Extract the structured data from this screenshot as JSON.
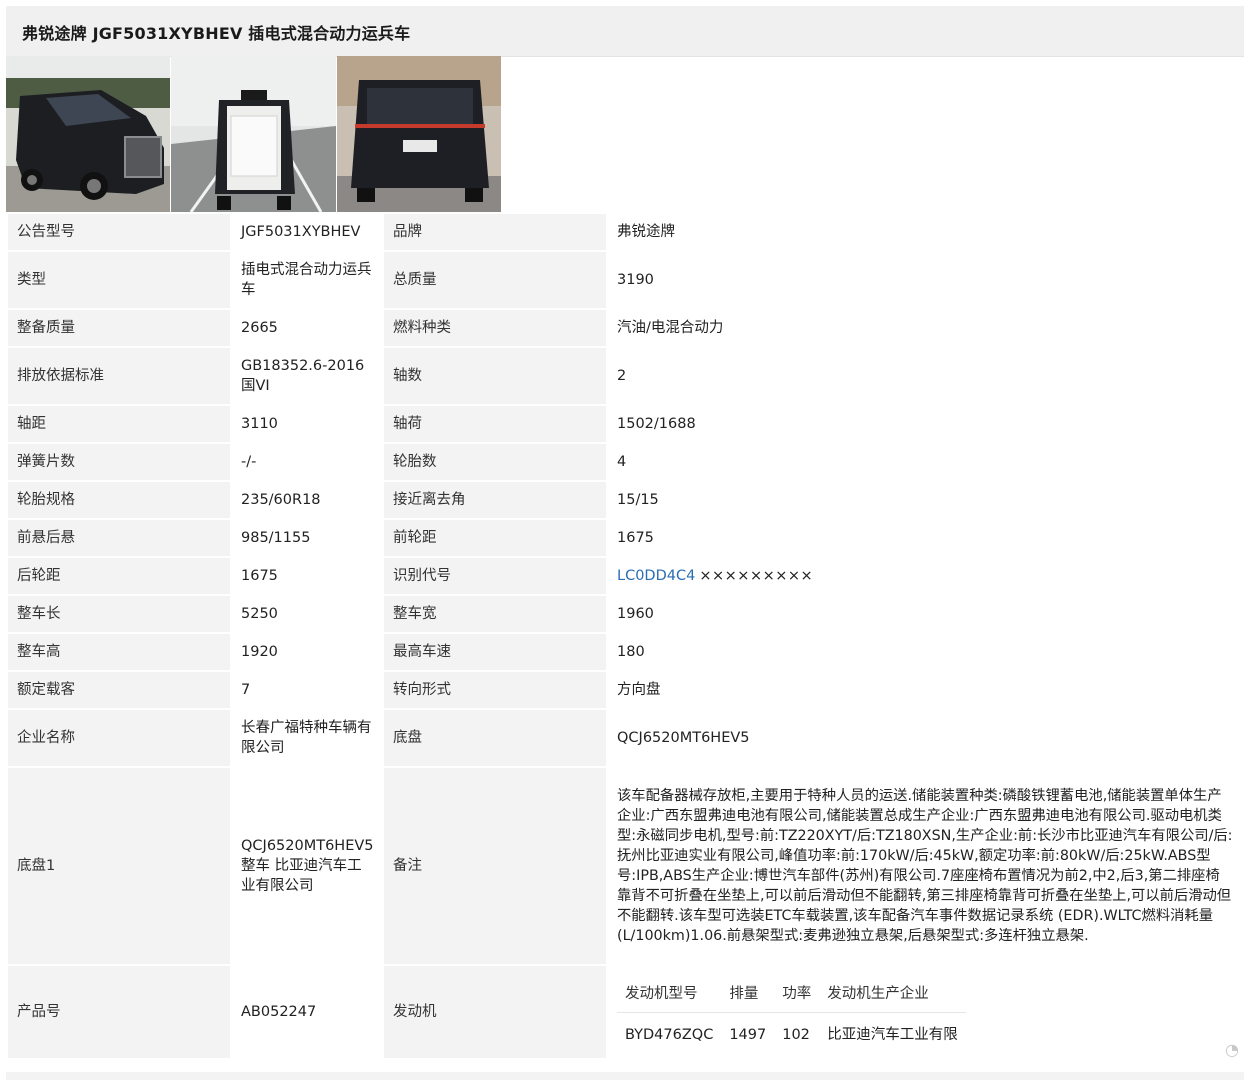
{
  "title": "弗锐途牌 JGF5031XYBHEV 插电式混合动力运兵车",
  "photos": [
    {
      "icon": "van-front-three-quarter-photo"
    },
    {
      "icon": "van-rear-open-door-photo"
    },
    {
      "icon": "van-rear-view-photo"
    }
  ],
  "specs": {
    "model_label": "公告型号",
    "model": "JGF5031XYBHEV",
    "brand_label": "品牌",
    "brand": "弗锐途牌",
    "type_label": "类型",
    "type": "插电式混合动力运兵车",
    "gross_mass_label": "总质量",
    "gross_mass": "3190",
    "curb_mass_label": "整备质量",
    "curb_mass": "2665",
    "fuel_label": "燃料种类",
    "fuel": "汽油/电混合动力",
    "emission_label": "排放依据标准",
    "emission": "GB18352.6-2016国VI",
    "axles_label": "轴数",
    "axles": "2",
    "wheelbase_label": "轴距",
    "wheelbase": "3110",
    "axle_load_label": "轴荷",
    "axle_load": "1502/1688",
    "springs_label": "弹簧片数",
    "springs": "-/-",
    "tires_count_label": "轮胎数",
    "tires_count": "4",
    "tire_spec_label": "轮胎规格",
    "tire_spec": "235/60R18",
    "angles_label": "接近离去角",
    "angles": "15/15",
    "overhang_label": "前悬后悬",
    "overhang": "985/1155",
    "front_track_label": "前轮距",
    "front_track": "1675",
    "rear_track_label": "后轮距",
    "rear_track": "1675",
    "vin_label": "识别代号",
    "vin": "LC0DD4C4",
    "vin_mask": "×××××××××",
    "length_label": "整车长",
    "length": "5250",
    "width_label": "整车宽",
    "width": "1960",
    "height_label": "整车高",
    "height": "1920",
    "top_speed_label": "最高车速",
    "top_speed": "180",
    "seats_label": "额定载客",
    "seats": "7",
    "steering_label": "转向形式",
    "steering": "方向盘",
    "company_label": "企业名称",
    "company": "长春广福特种车辆有限公司",
    "chassis_label": "底盘",
    "chassis": "QCJ6520MT6HEV5",
    "chassis1_label": "底盘1",
    "chassis1": "QCJ6520MT6HEV5 整车 比亚迪汽车工业有限公司",
    "notes_label": "备注",
    "notes": "该车配备器械存放柜,主要用于特种人员的运送.储能装置种类:磷酸铁锂蓄电池,储能装置单体生产企业:广西东盟弗迪电池有限公司,储能装置总成生产企业:广西东盟弗迪电池有限公司.驱动电机类型:永磁同步电机,型号:前:TZ220XYT/后:TZ180XSN,生产企业:前:长沙市比亚迪汽车有限公司/后:抚州比亚迪实业有限公司,峰值功率:前:170kW/后:45kW,额定功率:前:80kW/后:25kW.ABS型号:IPB,ABS生产企业:博世汽车部件(苏州)有限公司.7座座椅布置情况为前2,中2,后3,第二排座椅靠背不可折叠在坐垫上,可以前后滑动但不能翻转,第三排座椅靠背可折叠在坐垫上,可以前后滑动但不能翻转.该车型可选装ETC车载装置,该车配备汽车事件数据记录系统 (EDR).WLTC燃料消耗量(L/100km)1.06.前悬架型式:麦弗逊独立悬架,后悬架型式:多连杆独立悬架.",
    "product_no_label": "产品号",
    "product_no": "AB052247",
    "engine_label": "发动机"
  },
  "engine_table": {
    "headers": [
      "发动机型号",
      "排量",
      "功率",
      "发动机生产企业"
    ],
    "row": [
      "BYD476ZQC",
      "1497",
      "102",
      "比亚迪汽车工业有限"
    ]
  },
  "watermark_icon": "weibo-watermark-icon"
}
